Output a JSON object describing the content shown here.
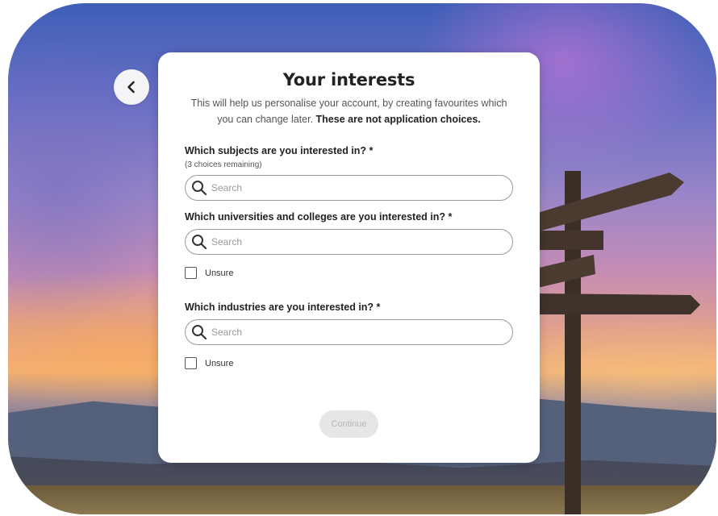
{
  "page": {
    "title": "Your interests",
    "subtitle_plain": "This will help us personalise your account, by creating favourites which you can change later. ",
    "subtitle_bold": "These are not application choices."
  },
  "back_button": {
    "icon": "chevron-left-icon"
  },
  "questions": {
    "subjects": {
      "label": "Which subjects are you interested in? *",
      "hint": "(3 choices remaining)",
      "search_placeholder": "Search"
    },
    "universities": {
      "label": "Which universities and colleges are you interested in? *",
      "search_placeholder": "Search",
      "unsure_label": "Unsure"
    },
    "industries": {
      "label": "Which industries are you interested in? *",
      "search_placeholder": "Search",
      "unsure_label": "Unsure"
    }
  },
  "continue_button": {
    "label": "Continue",
    "disabled": true
  },
  "colors": {
    "card_bg": "#ffffff",
    "text_primary": "#222222",
    "text_secondary": "#555555",
    "input_border": "#9a9a9a",
    "button_disabled_bg": "#e6e6e6",
    "button_disabled_text": "#b5b5b5"
  },
  "background": {
    "description_icon": "signpost-sunset-background"
  }
}
